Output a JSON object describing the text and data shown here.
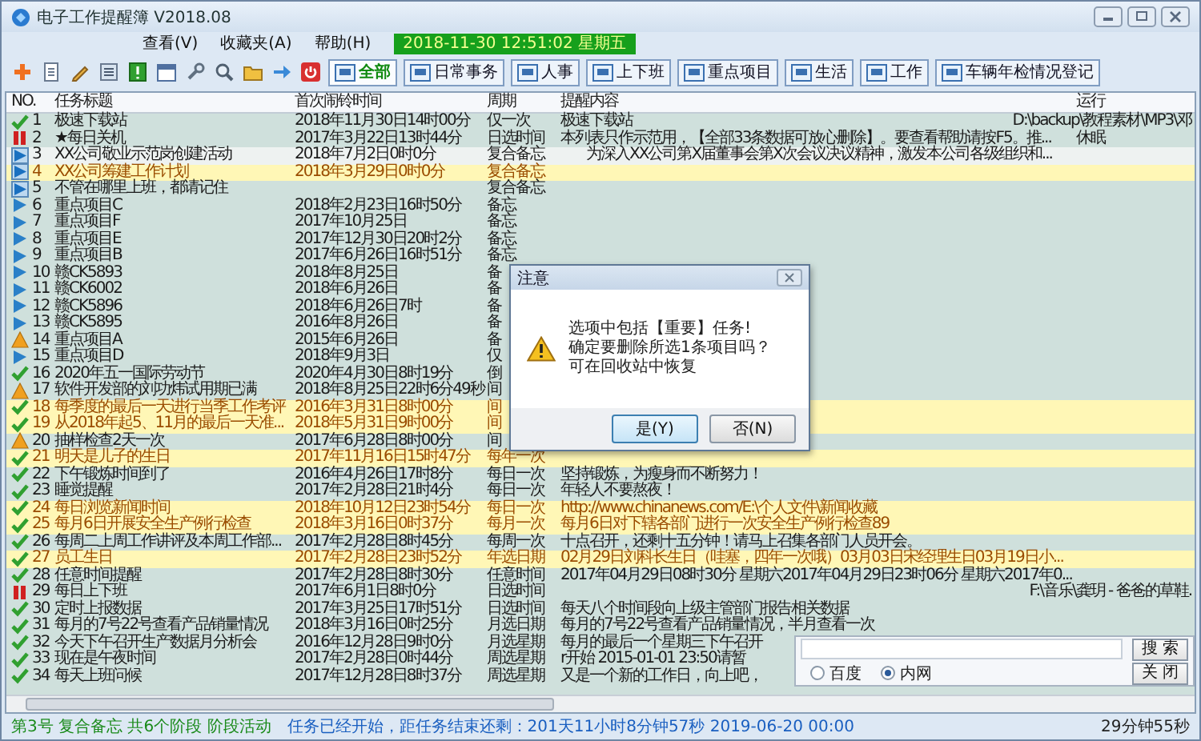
{
  "window": {
    "title": "电子工作提醒簿 V2018.08"
  },
  "menu": [
    {
      "label": "查看(V)"
    },
    {
      "label": "收藏夹(A)"
    },
    {
      "label": "帮助(H)"
    }
  ],
  "clock": "2018-11-30 12:51:02 星期五",
  "filters": [
    {
      "label": "全部",
      "selected": true
    },
    {
      "label": "日常事务",
      "selected": false
    },
    {
      "label": "人事",
      "selected": false
    },
    {
      "label": "上下班",
      "selected": false
    },
    {
      "label": "重点项目",
      "selected": false
    },
    {
      "label": "生活",
      "selected": false
    },
    {
      "label": "工作",
      "selected": false
    },
    {
      "label": "车辆年检情况登记",
      "selected": false
    }
  ],
  "table": {
    "columns": [
      "NO.",
      "任务标题",
      "首次闹铃时间",
      "周期",
      "提醒内容",
      "运行"
    ],
    "rows": [
      {
        "kind": "check",
        "no": "1",
        "title": "极速下载站",
        "time": "2018年11月30日14时00分",
        "cycle": "仅一次",
        "content": "极速下载站",
        "run": "D:\\backup\\教程素材\\MP3\\邓",
        "highlight": false,
        "selected": false
      },
      {
        "kind": "pause",
        "no": "2",
        "title": "★每日关机",
        "time": "2017年3月22日13时44分",
        "cycle": "日选时间",
        "content": "本列表只作示范用，【全部33条数据可放心删除】。要查看帮助请按F5。推...",
        "run": "休眠",
        "highlight": false,
        "selected": false
      },
      {
        "kind": "play-framed",
        "no": "3",
        "title": "XX公司敬业示范岗创建活动",
        "time": "2018年7月2日0时0分",
        "cycle": "复合备忘",
        "content": "为深入XX公司第X届董事会第X次会议决议精神，激发本公司各级组织和...",
        "highlight": false,
        "selected": true
      },
      {
        "kind": "play-framed",
        "no": "4",
        "title": "XX公司筹建工作计划",
        "time": "2018年3月29日0时0分",
        "cycle": "复合备忘",
        "highlight": true,
        "selected": false
      },
      {
        "kind": "play-framed",
        "no": "5",
        "title": "不管在哪里上班，都请记住",
        "cycle": "复合备忘",
        "highlight": false,
        "selected": false
      },
      {
        "kind": "play",
        "no": "6",
        "title": "重点项目C",
        "time": "2018年2月23日16时50分",
        "cycle": "备忘",
        "highlight": false,
        "selected": false
      },
      {
        "kind": "play",
        "no": "7",
        "title": "重点项目F",
        "time": "2017年10月25日",
        "cycle": "备忘",
        "highlight": false,
        "selected": false
      },
      {
        "kind": "play",
        "no": "8",
        "title": "重点项目E",
        "time": "2017年12月30日20时2分",
        "cycle": "备忘",
        "highlight": false,
        "selected": false
      },
      {
        "kind": "play",
        "no": "9",
        "title": "重点项目B",
        "time": "2017年6月26日16时51分",
        "cycle": "备忘",
        "highlight": false,
        "selected": false
      },
      {
        "kind": "play",
        "no": "10",
        "title": "赣CK5893",
        "time": "2018年8月25日",
        "cycle": "备",
        "highlight": false,
        "selected": false
      },
      {
        "kind": "play",
        "no": "11",
        "title": "赣CK6002",
        "time": "2018年6月26日",
        "cycle": "备",
        "highlight": false,
        "selected": false
      },
      {
        "kind": "play",
        "no": "12",
        "title": "赣CK5896",
        "time": "2018年6月26日7时",
        "cycle": "备",
        "highlight": false,
        "selected": false
      },
      {
        "kind": "play",
        "no": "13",
        "title": "赣CK5895",
        "time": "2016年8月26日",
        "cycle": "备",
        "highlight": false,
        "selected": false
      },
      {
        "kind": "warning",
        "no": "14",
        "title": "重点项目A",
        "time": "2015年6月26日",
        "cycle": "备",
        "highlight": false,
        "selected": false
      },
      {
        "kind": "play",
        "no": "15",
        "title": "重点项目D",
        "time": "2018年9月3日",
        "cycle": "仅",
        "highlight": false,
        "selected": false
      },
      {
        "kind": "check",
        "no": "16",
        "title": "2020年五一国际劳动节",
        "time": "2020年4月30日8时19分",
        "cycle": "倒",
        "highlight": false,
        "selected": false
      },
      {
        "kind": "warning",
        "no": "17",
        "title": "软件开发部的刘功炜试用期已满",
        "time": "2018年8月25日22时6分49秒",
        "cycle": "间",
        "highlight": false,
        "selected": false
      },
      {
        "kind": "check",
        "no": "18",
        "title": "每季度的最后一天进行当季工作考评",
        "time": "2016年3月31日8时00分",
        "cycle": "间",
        "highlight": true,
        "selected": false
      },
      {
        "kind": "check",
        "no": "19",
        "title": "从2018年起5、11月的最后一天准...",
        "time": "2018年5月31日9时00分",
        "cycle": "间",
        "highlight": true,
        "selected": false
      },
      {
        "kind": "warning",
        "no": "20",
        "title": "抽样检查2天一次",
        "time": "2017年6月28日8时00分",
        "cycle": "间",
        "highlight": false,
        "selected": false
      },
      {
        "kind": "check",
        "no": "21",
        "title": "明天是儿子的生日",
        "time": "2017年11月16日15时47分",
        "cycle": "每年一次",
        "highlight": true,
        "selected": false
      },
      {
        "kind": "check",
        "no": "22",
        "title": "下午锻炼时间到了",
        "time": "2016年4月26日17时8分",
        "cycle": "每日一次",
        "content": "坚持锻炼，为瘦身而不断努力！",
        "highlight": false,
        "selected": false
      },
      {
        "kind": "check",
        "no": "23",
        "title": "睡觉提醒",
        "time": "2017年2月28日21时4分",
        "cycle": "每日一次",
        "content": "年轻人不要熬夜！",
        "highlight": false,
        "selected": false
      },
      {
        "kind": "check",
        "no": "24",
        "title": "每日浏览新闻时间",
        "time": "2018年10月12日23时54分",
        "cycle": "每日一次",
        "content": "http://www.chinanews.com/E:\\个人文件\\新闻收藏",
        "highlight": true,
        "selected": false
      },
      {
        "kind": "check",
        "no": "25",
        "title": "每月6日开展安全生产例行检查",
        "time": "2018年3月16日0时37分",
        "cycle": "每月一次",
        "content": "每月6日对下辖各部门进行一次安全生产例行检查89",
        "highlight": true,
        "selected": false
      },
      {
        "kind": "check",
        "no": "26",
        "title": "每周二上周工作讲评及本周工作部...",
        "time": "2017年2月28日8时45分",
        "cycle": "每周一次",
        "content": "十点召开，还剩十五分钟！请马上召集各部门人员开会。",
        "highlight": false,
        "selected": false
      },
      {
        "kind": "check",
        "no": "27",
        "title": "员工生日",
        "time": "2017年2月28日23时52分",
        "cycle": "年选日期",
        "content": "02月29日刘科长生日（哇塞，四年一次哦）03月03日宋经理生日03月19日小...",
        "highlight": true,
        "selected": false
      },
      {
        "kind": "check",
        "no": "28",
        "title": "任意时间提醒",
        "time": "2017年2月28日8时30分",
        "cycle": "任意时间",
        "content": "2017年04月29日08时30分 星期六2017年04月29日23时06分 星期六2017年0...",
        "highlight": false,
        "selected": false
      },
      {
        "kind": "pause",
        "no": "29",
        "title": "每日上下班",
        "time": "2017年6月1日8时0分",
        "cycle": "日选时间",
        "run": "F:\\音乐\\龚玥 - 爸爸的草鞋.",
        "highlight": false,
        "selected": false
      },
      {
        "kind": "check",
        "no": "30",
        "title": "定时上报数据",
        "time": "2017年3月25日17时51分",
        "cycle": "日选时间",
        "content": "每天八个时间段向上级主管部门报告相关数据",
        "highlight": false,
        "selected": false
      },
      {
        "kind": "check",
        "no": "31",
        "title": "每月的7号22号查看产品销量情况",
        "time": "2018年3月16日0时25分",
        "cycle": "月选日期",
        "content": "每月的7号22号查看产品销量情况，半月查看一次",
        "highlight": false,
        "selected": false
      },
      {
        "kind": "check",
        "no": "32",
        "title": "今天下午召开生产数据月分析会",
        "time": "2016年12月28日9时0分",
        "cycle": "月选星期",
        "content": "每月的最后一个星期三下午召开",
        "highlight": false,
        "selected": false
      },
      {
        "kind": "check",
        "no": "33",
        "title": "现在是午夜时间",
        "time": "2017年2月28日0时44分",
        "cycle": "周选星期",
        "content": "r开始 2015-01-01 23:50请暂",
        "highlight": false,
        "selected": false
      },
      {
        "kind": "check",
        "no": "34",
        "title": "每天上班问候",
        "time": "2017年12月28日8时37分",
        "cycle": "周选星期",
        "content": "又是一个新的工作日，向上吧，",
        "highlight": false,
        "selected": false
      }
    ]
  },
  "dialog": {
    "title": "注意",
    "lines": [
      "选项中包括【重要】任务!",
      "确定要删除所选1条项目吗？",
      "可在回收站中恢复"
    ],
    "buttons": [
      "是(Y)",
      "否(N)"
    ]
  },
  "search_panel": {
    "engines": [
      {
        "label": "百度",
        "selected": false
      },
      {
        "label": "内网",
        "selected": true
      }
    ],
    "search_button": "搜 索",
    "close_button": "关 闭"
  },
  "status_bar": {
    "stage": "第3号 复合备忘 共6个阶段 阶段活动",
    "countdown": "任务已经开始，距任务结束还剩：201天11小时8分钟57秒 2019-06-20 00:00",
    "timer": "29分钟55秒"
  }
}
